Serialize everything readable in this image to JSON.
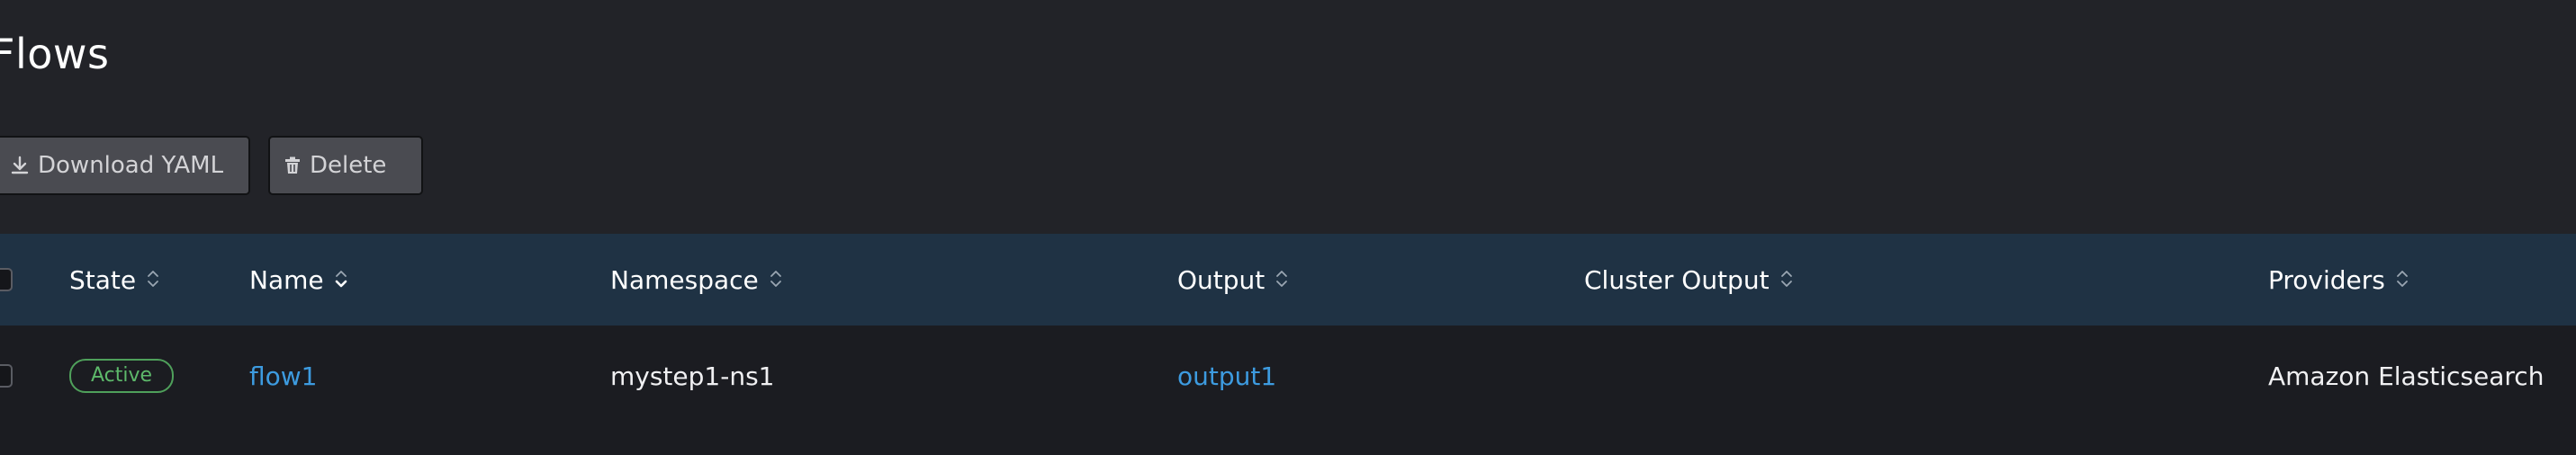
{
  "page": {
    "title": "Flows"
  },
  "toolbar": {
    "download_label": "Download YAML",
    "delete_label": "Delete"
  },
  "table": {
    "columns": [
      "State",
      "Name",
      "Namespace",
      "Output",
      "Cluster Output",
      "Providers"
    ],
    "rows": [
      {
        "state": "Active",
        "name": "flow1",
        "namespace": "mystep1-ns1",
        "output": "output1",
        "cluster_output": "",
        "providers": "Amazon Elasticsearch"
      }
    ]
  },
  "colors": {
    "background": "#222328",
    "header_bg": "#1f3244",
    "link": "#3d9be0",
    "active_badge": "#5db86a",
    "button_bg": "#4a4b51"
  },
  "icons": {
    "download": "download-icon",
    "delete": "trash-icon",
    "sort": "sort-icon"
  }
}
